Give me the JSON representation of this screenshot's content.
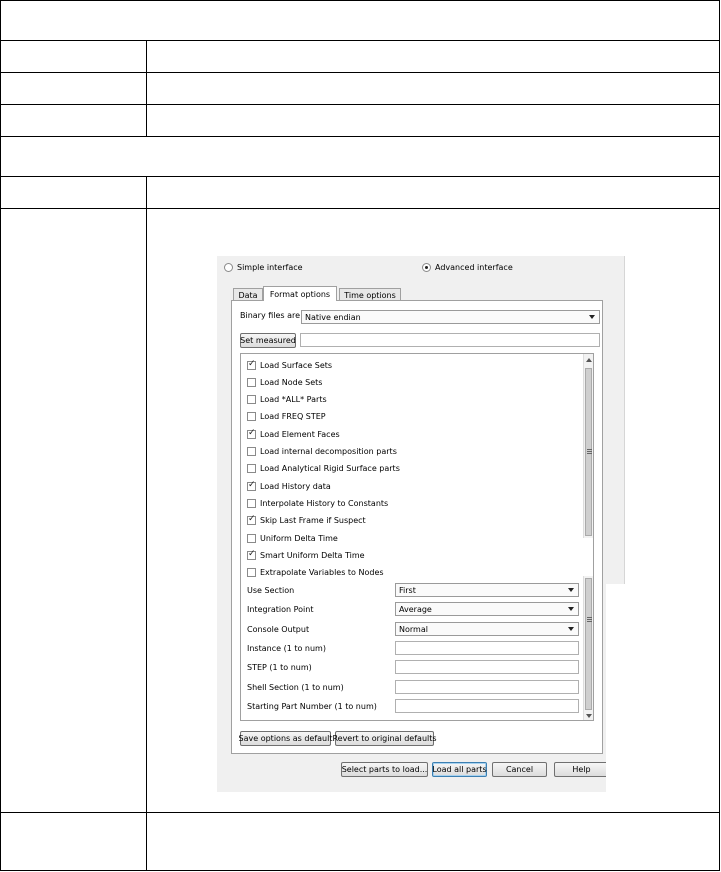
{
  "dialog": {
    "mode_simple": "Simple interface",
    "mode_advanced": "Advanced interface",
    "tabs": [
      "Data",
      "Format options",
      "Time options"
    ],
    "binary_label": "Binary files are:",
    "binary_value": "Native endian",
    "set_measured": "Set measured",
    "options": [
      {
        "label": "Load Surface Sets",
        "checked": true
      },
      {
        "label": "Load Node Sets",
        "checked": false
      },
      {
        "label": "Load *ALL* Parts",
        "checked": false
      },
      {
        "label": "Load FREQ STEP",
        "checked": false
      },
      {
        "label": "Load Element Faces",
        "checked": true
      },
      {
        "label": "Load internal decomposition parts",
        "checked": false
      },
      {
        "label": "Load Analytical Rigid Surface parts",
        "checked": false
      },
      {
        "label": "Load History data",
        "checked": true
      },
      {
        "label": "Interpolate History to Constants",
        "checked": false
      },
      {
        "label": "Skip Last Frame if Suspect",
        "checked": true
      },
      {
        "label": "Uniform Delta Time",
        "checked": false
      },
      {
        "label": "Smart Uniform Delta Time",
        "checked": true
      },
      {
        "label": "Extrapolate Variables to Nodes",
        "checked": false
      }
    ],
    "selects": [
      {
        "label": "Use Section",
        "value": "First"
      },
      {
        "label": "Integration Point",
        "value": "Average"
      },
      {
        "label": "Console Output",
        "value": "Normal"
      }
    ],
    "fields": [
      {
        "label": "Instance (1 to num)",
        "value": ""
      },
      {
        "label": "STEP (1 to num)",
        "value": ""
      },
      {
        "label": "Shell Section (1 to num)",
        "value": ""
      },
      {
        "label": "Starting Part Number (1 to num)",
        "value": ""
      }
    ],
    "save_default": "Save options as default",
    "revert_default": "Revert to original defaults",
    "select_parts": "Select parts to load...",
    "load_all": "Load all parts",
    "cancel": "Cancel",
    "help": "Help"
  }
}
